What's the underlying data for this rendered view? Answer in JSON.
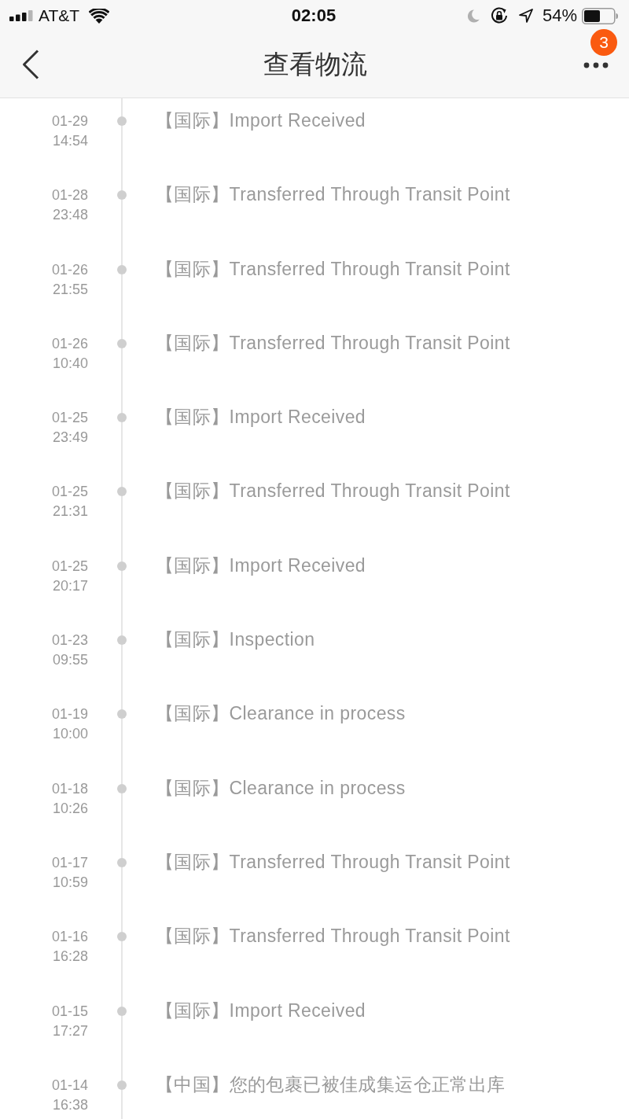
{
  "status_bar": {
    "carrier": "AT&T",
    "time": "02:05",
    "battery": "54%"
  },
  "nav": {
    "title": "查看物流",
    "badge": "3"
  },
  "events": [
    {
      "date": "01-29",
      "time": "14:54",
      "text": "【国际】Import Received"
    },
    {
      "date": "01-28",
      "time": "23:48",
      "text": "【国际】Transferred Through Transit Point"
    },
    {
      "date": "01-26",
      "time": "21:55",
      "text": "【国际】Transferred Through Transit Point"
    },
    {
      "date": "01-26",
      "time": "10:40",
      "text": "【国际】Transferred Through Transit Point"
    },
    {
      "date": "01-25",
      "time": "23:49",
      "text": "【国际】Import Received"
    },
    {
      "date": "01-25",
      "time": "21:31",
      "text": "【国际】Transferred Through Transit Point"
    },
    {
      "date": "01-25",
      "time": "20:17",
      "text": "【国际】Import Received"
    },
    {
      "date": "01-23",
      "time": "09:55",
      "text": "【国际】Inspection"
    },
    {
      "date": "01-19",
      "time": "10:00",
      "text": "【国际】Clearance in process"
    },
    {
      "date": "01-18",
      "time": "10:26",
      "text": "【国际】Clearance in process"
    },
    {
      "date": "01-17",
      "time": "10:59",
      "text": "【国际】Transferred Through Transit Point"
    },
    {
      "date": "01-16",
      "time": "16:28",
      "text": "【国际】Transferred Through Transit Point"
    },
    {
      "date": "01-15",
      "time": "17:27",
      "text": "【国际】Import Received"
    },
    {
      "date": "01-14",
      "time": "16:38",
      "text": "【中国】您的包裹已被佳成集运仓正常出库"
    }
  ]
}
